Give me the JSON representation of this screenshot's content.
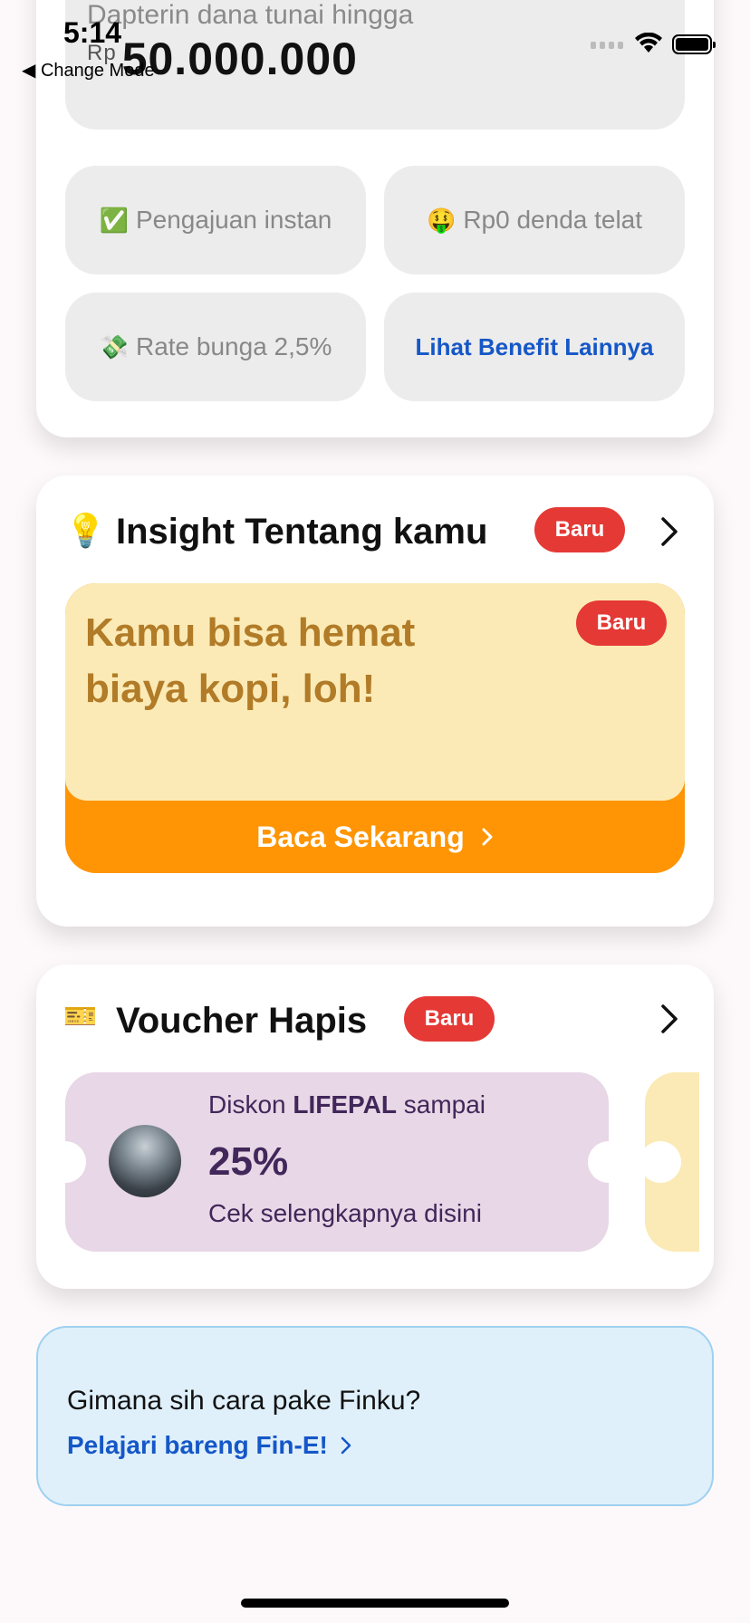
{
  "status_bar": {
    "time": "5:14",
    "back_label": "◀ Change Mode"
  },
  "loan": {
    "subtitle": "Dapterin dana tunai hingga",
    "currency": "Rp",
    "amount": "50.000.000",
    "benefits": [
      {
        "icon": "✅",
        "label": "Pengajuan instan"
      },
      {
        "icon": "🤑",
        "label": "Rp0 denda telat"
      },
      {
        "icon": "💸",
        "label": "Rate bunga 2,5%"
      }
    ],
    "more_benefits_link": "Lihat Benefit Lainnya"
  },
  "insight": {
    "icon": "💡",
    "title": "Insight Tentang kamu",
    "badge": "Baru",
    "card_badge": "Baru",
    "card_text": "Kamu bisa hemat biaya kopi, loh!",
    "cta": "Baca Sekarang"
  },
  "voucher": {
    "icon": "🎫",
    "title": "Voucher Hapis",
    "badge": "Baru",
    "item": {
      "line1_prefix": "Diskon ",
      "line1_brand": "LIFEPAL",
      "line1_suffix": " sampai",
      "discount": "25%",
      "line3": "Cek selengkapnya disini"
    }
  },
  "help": {
    "question": "Gimana sih cara pake Finku?",
    "link": "Pelajari bareng Fin-E!"
  },
  "colors": {
    "badge_red": "#e53935",
    "cta_orange": "#ff9504",
    "insight_yellow": "#fbeab5",
    "link_blue": "#1557c7",
    "voucher_purple": "#e8d7e6"
  }
}
